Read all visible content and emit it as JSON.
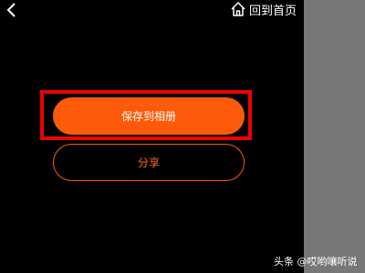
{
  "header": {
    "home_label": "回到首页"
  },
  "actions": {
    "save_label": "保存到相册",
    "share_label": "分享"
  },
  "watermark": {
    "text": "头条 @哎哟嚷听说"
  },
  "colors": {
    "accent": "#ff5a0a",
    "highlight": "#ee0000",
    "side_panel": "#777777"
  }
}
